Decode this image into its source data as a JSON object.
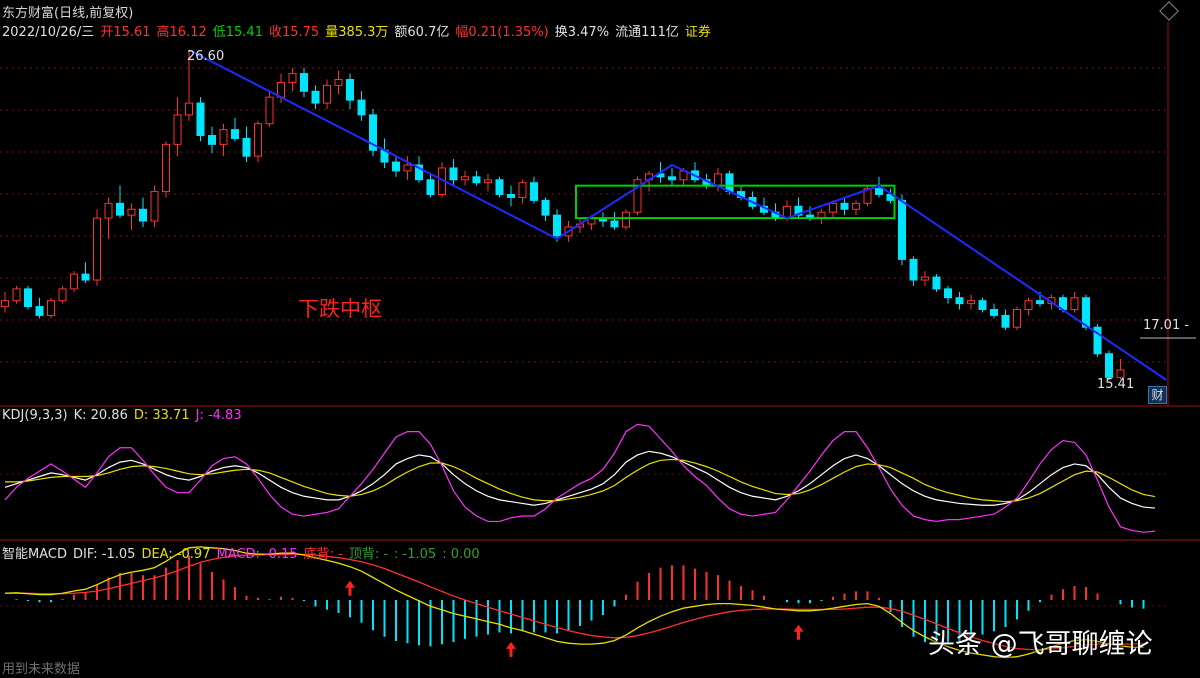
{
  "header": {
    "title": "东方财富(日线,前复权)",
    "date": "2022/10/26/三",
    "open": "开15.61",
    "high": "高16.12",
    "low": "低15.41",
    "close": "收15.75",
    "volume": "量385.3万",
    "amount": "额60.7亿",
    "change": "幅0.21(1.35%)",
    "turnover": "换3.47%",
    "float_cap": "流通111亿",
    "sector": "证券"
  },
  "annotations": {
    "pivot_label": "下跌中枢",
    "high_price": "26.60",
    "current_price": "17.01 -",
    "low_price": "15.41",
    "low_marker": "财"
  },
  "kdj": {
    "name": "KDJ(9,3,3)",
    "k": "K: 20.86",
    "d": "D: 33.71",
    "j": "J: -4.83"
  },
  "macd": {
    "name": "智能MACD",
    "dif": "DIF: -1.05",
    "dea": "DEA: -0.97",
    "macd": "MACD: -0.15",
    "bottom_div": "底背: -",
    "top_div": "顶背: -",
    "v1": ": -1.05",
    "v2": ": 0.00"
  },
  "footer": {
    "future_data": "用到未来数据"
  },
  "watermark": "头条 @飞哥聊缠论",
  "colors": {
    "up": "#ff3030",
    "down": "#00e5ff",
    "trend_line": "#1c2cff",
    "pivot_box": "#00d000",
    "k_line": "#ffffff",
    "d_line": "#e8e000",
    "j_line": "#ff30ff",
    "dif_line": "#e8e000"
  },
  "chart_data": {
    "type": "candlestick",
    "title": "东方财富(日线,前复权)",
    "price_high": 26.6,
    "price_low": 15.41,
    "last_close": 15.75,
    "candles": [
      [
        17.9,
        18.4,
        17.7,
        18.1
      ],
      [
        18.1,
        18.6,
        18.0,
        18.5
      ],
      [
        18.5,
        18.6,
        17.8,
        17.9
      ],
      [
        17.9,
        18.2,
        17.5,
        17.6
      ],
      [
        17.6,
        18.2,
        17.5,
        18.1
      ],
      [
        18.1,
        18.6,
        18.0,
        18.5
      ],
      [
        18.5,
        19.1,
        18.4,
        19.0
      ],
      [
        19.0,
        19.4,
        18.7,
        18.8
      ],
      [
        18.8,
        21.2,
        18.6,
        20.9
      ],
      [
        20.9,
        21.6,
        20.2,
        21.4
      ],
      [
        21.4,
        22.0,
        20.9,
        21.0
      ],
      [
        21.0,
        21.4,
        20.5,
        21.2
      ],
      [
        21.2,
        21.6,
        20.6,
        20.8
      ],
      [
        20.8,
        22.0,
        20.6,
        21.8
      ],
      [
        21.8,
        23.5,
        21.6,
        23.4
      ],
      [
        23.4,
        25.0,
        23.0,
        24.4
      ],
      [
        24.4,
        26.6,
        24.2,
        24.8
      ],
      [
        24.8,
        25.0,
        23.5,
        23.7
      ],
      [
        23.7,
        24.0,
        23.1,
        23.4
      ],
      [
        23.4,
        24.1,
        23.0,
        23.9
      ],
      [
        23.9,
        24.3,
        23.5,
        23.6
      ],
      [
        23.6,
        24.0,
        22.8,
        23.0
      ],
      [
        23.0,
        24.2,
        22.8,
        24.1
      ],
      [
        24.1,
        25.2,
        24.0,
        25.0
      ],
      [
        25.0,
        25.8,
        24.8,
        25.5
      ],
      [
        25.5,
        26.0,
        25.2,
        25.8
      ],
      [
        25.8,
        26.0,
        25.0,
        25.2
      ],
      [
        25.2,
        25.4,
        24.6,
        24.8
      ],
      [
        24.8,
        25.6,
        24.6,
        25.4
      ],
      [
        25.4,
        25.9,
        25.1,
        25.6
      ],
      [
        25.6,
        25.8,
        24.6,
        24.9
      ],
      [
        24.9,
        25.2,
        24.2,
        24.4
      ],
      [
        24.4,
        24.6,
        23.0,
        23.2
      ],
      [
        23.2,
        23.6,
        22.6,
        22.8
      ],
      [
        22.8,
        23.0,
        22.3,
        22.5
      ],
      [
        22.5,
        23.0,
        22.2,
        22.7
      ],
      [
        22.7,
        23.0,
        22.1,
        22.2
      ],
      [
        22.2,
        22.4,
        21.6,
        21.7
      ],
      [
        21.7,
        22.8,
        21.6,
        22.6
      ],
      [
        22.6,
        22.9,
        22.0,
        22.2
      ],
      [
        22.2,
        22.5,
        22.0,
        22.3
      ],
      [
        22.3,
        22.5,
        22.0,
        22.1
      ],
      [
        22.1,
        22.4,
        21.8,
        22.2
      ],
      [
        22.2,
        22.3,
        21.6,
        21.7
      ],
      [
        21.7,
        22.0,
        21.3,
        21.6
      ],
      [
        21.6,
        22.2,
        21.4,
        22.1
      ],
      [
        22.1,
        22.3,
        21.4,
        21.5
      ],
      [
        21.5,
        21.6,
        20.8,
        21.0
      ],
      [
        21.0,
        21.2,
        20.1,
        20.3
      ],
      [
        20.3,
        20.8,
        20.1,
        20.6
      ],
      [
        20.6,
        20.9,
        20.4,
        20.7
      ],
      [
        20.7,
        21.0,
        20.5,
        20.9
      ],
      [
        20.9,
        21.1,
        20.6,
        20.8
      ],
      [
        20.8,
        21.1,
        20.5,
        20.6
      ],
      [
        20.6,
        21.2,
        20.5,
        21.1
      ],
      [
        21.1,
        22.3,
        21.0,
        22.2
      ],
      [
        22.2,
        22.5,
        21.8,
        22.4
      ],
      [
        22.4,
        22.8,
        22.1,
        22.3
      ],
      [
        22.3,
        22.6,
        22.0,
        22.2
      ],
      [
        22.2,
        22.6,
        22.0,
        22.5
      ],
      [
        22.5,
        22.8,
        22.1,
        22.2
      ],
      [
        22.2,
        22.4,
        21.9,
        22.0
      ],
      [
        22.0,
        22.6,
        21.8,
        22.4
      ],
      [
        22.4,
        22.5,
        21.7,
        21.8
      ],
      [
        21.8,
        22.0,
        21.5,
        21.6
      ],
      [
        21.6,
        21.8,
        21.2,
        21.3
      ],
      [
        21.3,
        21.6,
        21.0,
        21.1
      ],
      [
        21.1,
        21.4,
        20.8,
        20.9
      ],
      [
        20.9,
        21.5,
        20.8,
        21.3
      ],
      [
        21.3,
        21.6,
        20.9,
        21.0
      ],
      [
        21.0,
        21.3,
        20.8,
        20.9
      ],
      [
        20.9,
        21.2,
        20.7,
        21.1
      ],
      [
        21.1,
        21.5,
        20.9,
        21.4
      ],
      [
        21.4,
        21.6,
        21.0,
        21.2
      ],
      [
        21.2,
        21.5,
        21.0,
        21.4
      ],
      [
        21.4,
        22.0,
        21.3,
        21.9
      ],
      [
        21.9,
        22.3,
        21.6,
        21.7
      ],
      [
        21.7,
        21.9,
        21.4,
        21.5
      ],
      [
        21.5,
        21.7,
        19.3,
        19.5
      ],
      [
        19.5,
        19.6,
        18.6,
        18.8
      ],
      [
        18.8,
        19.1,
        18.6,
        18.9
      ],
      [
        18.9,
        19.0,
        18.4,
        18.5
      ],
      [
        18.5,
        18.6,
        18.0,
        18.2
      ],
      [
        18.2,
        18.4,
        17.8,
        18.0
      ],
      [
        18.0,
        18.3,
        17.8,
        18.1
      ],
      [
        18.1,
        18.2,
        17.7,
        17.8
      ],
      [
        17.8,
        18.0,
        17.5,
        17.6
      ],
      [
        17.6,
        17.8,
        17.1,
        17.2
      ],
      [
        17.2,
        17.9,
        17.1,
        17.8
      ],
      [
        17.8,
        18.2,
        17.6,
        18.1
      ],
      [
        18.1,
        18.4,
        17.9,
        18.0
      ],
      [
        18.0,
        18.3,
        17.8,
        18.2
      ],
      [
        18.2,
        18.3,
        17.7,
        17.8
      ],
      [
        17.8,
        18.4,
        17.7,
        18.2
      ],
      [
        18.2,
        18.3,
        17.1,
        17.2
      ],
      [
        17.2,
        17.3,
        16.2,
        16.3
      ],
      [
        16.3,
        16.4,
        15.41,
        15.5
      ],
      [
        15.5,
        16.12,
        15.41,
        15.75
      ]
    ],
    "trend_lines": [
      {
        "from": [
          16,
          26.6
        ],
        "to": [
          48,
          20.2
        ]
      },
      {
        "from": [
          48,
          20.2
        ],
        "to": [
          58,
          22.7
        ]
      },
      {
        "from": [
          58,
          22.7
        ],
        "to": [
          68,
          20.9
        ]
      },
      {
        "from": [
          68,
          20.9
        ],
        "to": [
          76,
          22.0
        ]
      },
      {
        "from": [
          76,
          22.0
        ],
        "to": [
          101,
          15.41
        ]
      }
    ],
    "pivot_box": {
      "from_index": 50,
      "to_index": 77,
      "top": 22.0,
      "bottom": 20.9
    },
    "kdj": {
      "k": [
        44,
        48,
        52,
        56,
        60,
        58,
        55,
        52,
        58,
        66,
        72,
        74,
        70,
        64,
        58,
        54,
        52,
        56,
        62,
        66,
        68,
        66,
        60,
        52,
        44,
        38,
        34,
        32,
        30,
        30,
        34,
        40,
        48,
        58,
        70,
        76,
        80,
        78,
        70,
        58,
        48,
        40,
        34,
        30,
        28,
        26,
        24,
        26,
        30,
        34,
        38,
        42,
        48,
        58,
        72,
        80,
        84,
        82,
        78,
        72,
        66,
        60,
        52,
        44,
        38,
        34,
        32,
        30,
        34,
        40,
        48,
        58,
        68,
        76,
        80,
        76,
        68,
        58,
        48,
        40,
        34,
        30,
        28,
        26,
        25,
        24,
        24,
        26,
        30,
        38,
        48,
        58,
        66,
        70,
        68,
        58,
        44,
        32,
        26,
        22,
        20.86
      ],
      "d": [
        50,
        50,
        51,
        53,
        55,
        56,
        56,
        56,
        57,
        60,
        64,
        67,
        68,
        67,
        65,
        62,
        59,
        58,
        59,
        61,
        63,
        64,
        63,
        60,
        55,
        50,
        45,
        41,
        37,
        35,
        34,
        36,
        40,
        46,
        54,
        61,
        67,
        71,
        71,
        67,
        61,
        54,
        48,
        42,
        37,
        33,
        30,
        29,
        29,
        31,
        33,
        36,
        40,
        46,
        55,
        63,
        70,
        74,
        75,
        74,
        71,
        67,
        62,
        56,
        50,
        45,
        41,
        37,
        36,
        37,
        41,
        47,
        54,
        61,
        67,
        70,
        69,
        66,
        60,
        54,
        47,
        42,
        38,
        35,
        32,
        30,
        29,
        28,
        29,
        32,
        37,
        44,
        51,
        58,
        62,
        61,
        55,
        48,
        41,
        36,
        33.71
      ],
      "j": [
        30,
        44,
        54,
        62,
        70,
        62,
        53,
        44,
        60,
        78,
        88,
        88,
        74,
        58,
        44,
        38,
        38,
        52,
        68,
        76,
        78,
        70,
        54,
        36,
        22,
        14,
        12,
        14,
        16,
        20,
        34,
        48,
        64,
        82,
        100,
        106,
        106,
        92,
        68,
        40,
        22,
        12,
        6,
        6,
        10,
        12,
        12,
        20,
        32,
        40,
        48,
        54,
        64,
        82,
        106,
        114,
        112,
        98,
        84,
        68,
        56,
        46,
        32,
        20,
        14,
        12,
        14,
        16,
        30,
        46,
        62,
        80,
        96,
        106,
        106,
        88,
        66,
        42,
        24,
        12,
        8,
        6,
        8,
        8,
        10,
        12,
        14,
        22,
        32,
        50,
        70,
        86,
        96,
        94,
        80,
        52,
        22,
        0,
        -4,
        -6,
        -4.83
      ]
    },
    "macd": {
      "dif": [
        0.15,
        0.16,
        0.14,
        0.12,
        0.12,
        0.15,
        0.2,
        0.24,
        0.34,
        0.46,
        0.56,
        0.62,
        0.66,
        0.72,
        0.86,
        1.02,
        1.16,
        1.18,
        1.16,
        1.14,
        1.1,
        1.04,
        1.02,
        1.02,
        1.04,
        1.04,
        1.0,
        0.94,
        0.88,
        0.82,
        0.74,
        0.64,
        0.5,
        0.36,
        0.22,
        0.1,
        -0.02,
        -0.14,
        -0.22,
        -0.3,
        -0.36,
        -0.42,
        -0.48,
        -0.54,
        -0.62,
        -0.68,
        -0.76,
        -0.84,
        -0.92,
        -0.96,
        -0.98,
        -0.98,
        -0.96,
        -0.9,
        -0.78,
        -0.62,
        -0.48,
        -0.36,
        -0.26,
        -0.18,
        -0.14,
        -0.1,
        -0.08,
        -0.08,
        -0.1,
        -0.12,
        -0.16,
        -0.2,
        -0.22,
        -0.24,
        -0.24,
        -0.22,
        -0.18,
        -0.14,
        -0.1,
        -0.08,
        -0.14,
        -0.3,
        -0.5,
        -0.68,
        -0.82,
        -0.94,
        -1.04,
        -1.12,
        -1.18,
        -1.22,
        -1.26,
        -1.28,
        -1.26,
        -1.2,
        -1.12,
        -1.04,
        -0.96,
        -0.9,
        -0.88,
        -0.92,
        -0.98,
        -1.02,
        -1.05,
        -1.05
      ],
      "dea": [
        0.15,
        0.15,
        0.15,
        0.14,
        0.14,
        0.14,
        0.15,
        0.17,
        0.2,
        0.25,
        0.31,
        0.37,
        0.43,
        0.49,
        0.56,
        0.65,
        0.75,
        0.84,
        0.9,
        0.95,
        0.98,
        1.0,
        1.0,
        1.01,
        1.01,
        1.02,
        1.01,
        1.0,
        0.97,
        0.94,
        0.9,
        0.85,
        0.78,
        0.7,
        0.6,
        0.5,
        0.4,
        0.29,
        0.19,
        0.09,
        0.0,
        -0.08,
        -0.16,
        -0.24,
        -0.31,
        -0.39,
        -0.46,
        -0.54,
        -0.61,
        -0.68,
        -0.74,
        -0.79,
        -0.82,
        -0.84,
        -0.83,
        -0.79,
        -0.73,
        -0.66,
        -0.58,
        -0.5,
        -0.43,
        -0.36,
        -0.31,
        -0.26,
        -0.23,
        -0.21,
        -0.2,
        -0.2,
        -0.2,
        -0.21,
        -0.21,
        -0.21,
        -0.21,
        -0.2,
        -0.18,
        -0.16,
        -0.16,
        -0.19,
        -0.25,
        -0.34,
        -0.43,
        -0.53,
        -0.63,
        -0.73,
        -0.82,
        -0.9,
        -0.97,
        -1.03,
        -1.08,
        -1.1,
        -1.1,
        -1.09,
        -1.06,
        -1.03,
        -1.0,
        -0.98,
        -0.98,
        -0.98,
        -0.98,
        -0.97
      ],
      "buy_arrows": [
        30,
        44,
        69
      ]
    }
  }
}
